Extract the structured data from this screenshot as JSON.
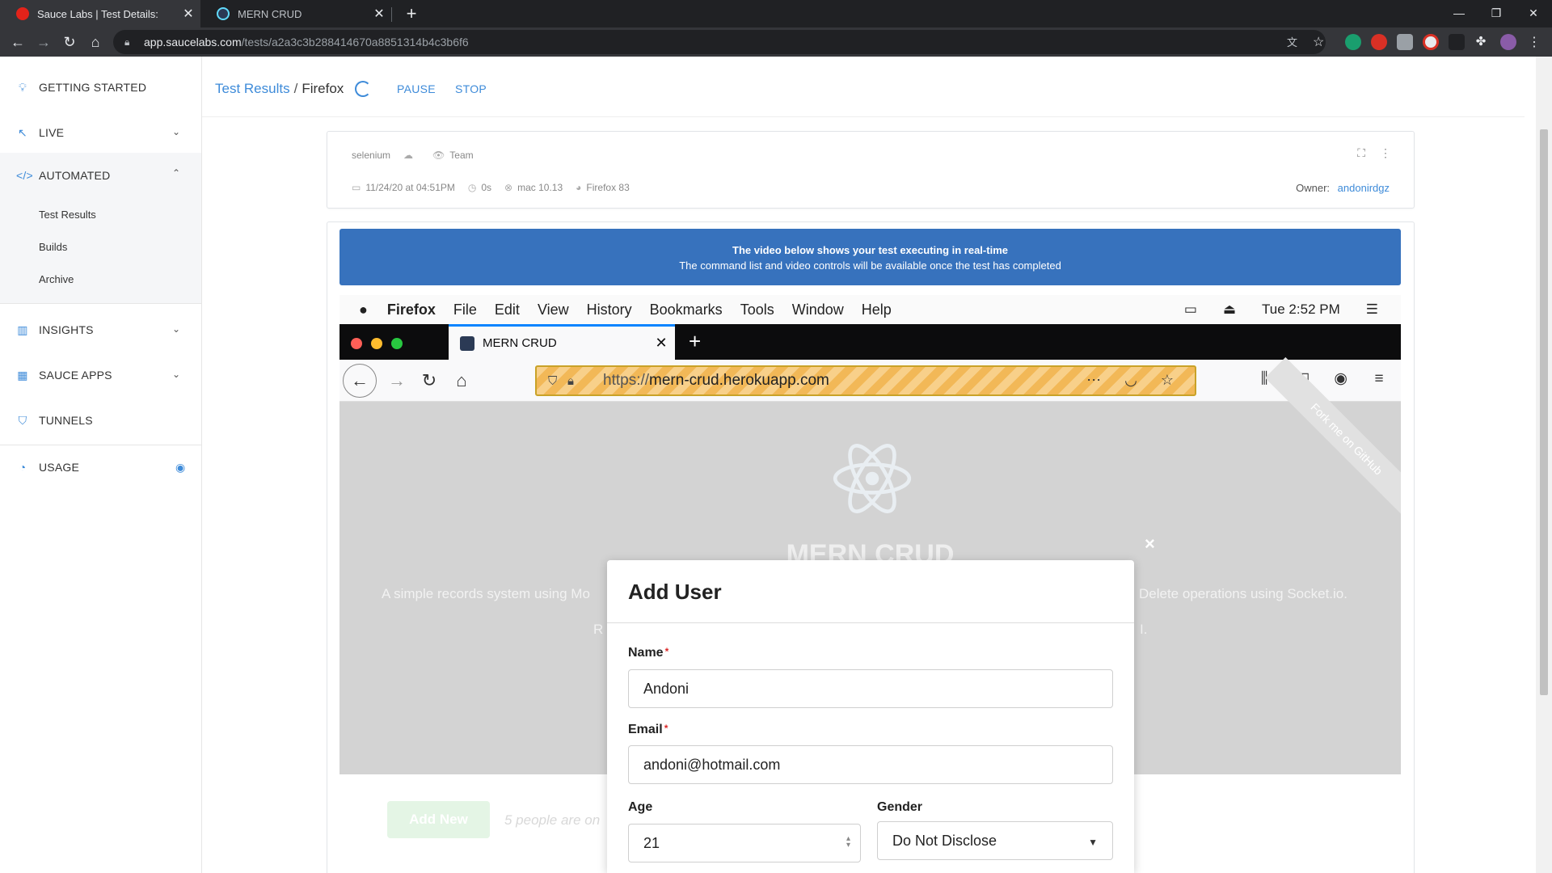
{
  "browser": {
    "tabs": [
      {
        "title": "Sauce Labs | Test Details:",
        "active": true,
        "favicon_color": "#e2231a"
      },
      {
        "title": "MERN CRUD",
        "active": false,
        "favicon_color": "#61dafb"
      }
    ],
    "new_tab": "+",
    "window_controls": {
      "minimize": "—",
      "restore": "❐",
      "close": "✕"
    },
    "url_host": "app.saucelabs.com",
    "url_path": "/tests/a2a3c3b288414670a8851314b4c3b6f6"
  },
  "sidebar": {
    "items": [
      {
        "label": "GETTING STARTED",
        "icon": "lightbulb-icon"
      },
      {
        "label": "LIVE",
        "icon": "cursor-icon"
      },
      {
        "label": "AUTOMATED",
        "icon": "code-icon"
      },
      {
        "label": "INSIGHTS",
        "icon": "bar-chart-icon"
      },
      {
        "label": "SAUCE APPS",
        "icon": "grid-icon"
      },
      {
        "label": "TUNNELS",
        "icon": "shield-icon"
      },
      {
        "label": "USAGE",
        "icon": "gauge-icon"
      }
    ],
    "automated_sub": [
      "Test Results",
      "Builds",
      "Archive"
    ]
  },
  "header": {
    "crumb_root": "Test Results",
    "separator": "/",
    "crumb_current": "Firefox",
    "pause_label": "PAUSE",
    "stop_label": "STOP"
  },
  "test_info": {
    "framework": "selenium",
    "visibility": "Team",
    "date": "11/24/20 at 04:51PM",
    "duration": "0s",
    "os": "mac 10.13",
    "browser": "Firefox 83",
    "owner_label": "Owner:",
    "owner": "andonirdgz"
  },
  "banner": {
    "line1": "The video below shows your test executing in real-time",
    "line2": "The command list and video controls will be available once the test has completed"
  },
  "video": {
    "mac_menu": [
      "Firefox",
      "File",
      "Edit",
      "View",
      "History",
      "Bookmarks",
      "Tools",
      "Window",
      "Help"
    ],
    "clock": "Tue 2:52 PM",
    "ff_tab_title": "MERN CRUD",
    "ff_url_scheme": "https://",
    "ff_url_domain": "mern-crud.herokuapp.com",
    "page_title": "MERN CRUD",
    "ribbon": "Fork me on GitHub",
    "text_left_1": "A simple records system using Mo",
    "text_right_1": "Delete operations using Socket.io.",
    "text_left_2": "R",
    "text_right_2": "I."
  },
  "modal": {
    "title": "Add User",
    "close": "×",
    "name_label": "Name",
    "name_value": "Andoni",
    "email_label": "Email",
    "email_value": "andoni@hotmail.com",
    "age_label": "Age",
    "age_value": "21",
    "gender_label": "Gender",
    "gender_value": "Do Not Disclose",
    "required_mark": "*"
  },
  "page_below": {
    "add_new": "Add New",
    "people_text": "5 people are on"
  }
}
